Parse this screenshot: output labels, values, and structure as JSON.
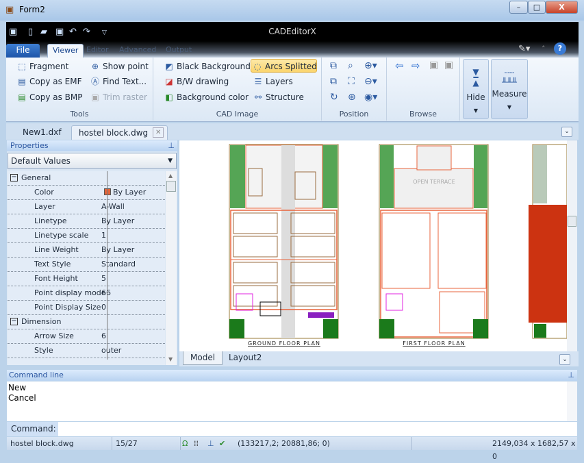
{
  "window": {
    "title": "Form2",
    "app_title": "CADEditorX",
    "min": "–",
    "max": "□",
    "close": "X"
  },
  "ribbon_tabs": [
    "File",
    "Viewer",
    "Editor",
    "Advanced",
    "Output"
  ],
  "ribbon": {
    "tools": {
      "label": "Tools",
      "items": [
        "Fragment",
        "Copy as EMF",
        "Copy as BMP",
        "Show point",
        "Find Text...",
        "Trim raster"
      ]
    },
    "cad_image": {
      "label": "CAD Image",
      "items": [
        "Black Background",
        "B/W drawing",
        "Background color",
        "Arcs Splitted",
        "Layers",
        "Structure"
      ]
    },
    "position": {
      "label": "Position"
    },
    "browse": {
      "label": "Browse"
    },
    "hide": "Hide",
    "measure": "Measure"
  },
  "doc_tabs": [
    "New1.dxf",
    "hostel block.dwg"
  ],
  "properties": {
    "title": "Properties",
    "combo": "Default Values",
    "rows": [
      {
        "cat": true,
        "k": "General"
      },
      {
        "k": "Color",
        "v": "By Layer",
        "swatch": "#e2643a"
      },
      {
        "k": "Layer",
        "v": "A-Wall"
      },
      {
        "k": "Linetype",
        "v": "By Layer"
      },
      {
        "k": "Linetype scale",
        "v": "1"
      },
      {
        "k": "Line Weight",
        "v": "By Layer"
      },
      {
        "k": "Text Style",
        "v": "Standard"
      },
      {
        "k": "Font Height",
        "v": "5"
      },
      {
        "k": "Point display mode",
        "v": "66"
      },
      {
        "k": "Point Display Size",
        "v": "0"
      },
      {
        "cat": true,
        "k": "Dimension"
      },
      {
        "k": "Arrow Size",
        "v": "6"
      },
      {
        "k": "Style",
        "v": "outer"
      }
    ]
  },
  "drawing": {
    "plan1": "GROUND FLOOR PLAN",
    "plan2": "FIRST FLOOR PLAN",
    "terrace": "OPEN TERRACE"
  },
  "layout_tabs": [
    "Model",
    "Layout2"
  ],
  "command": {
    "title": "Command line",
    "history": [
      "New",
      "Cancel"
    ],
    "label": "Command:",
    "value": ""
  },
  "status": {
    "file": "hostel block.dwg",
    "count": "15/27",
    "coords": "(133217,2; 20881,86; 0)",
    "size": "2149,034 x 1682,57 x 0"
  },
  "colors": {
    "wall": "#e8643c",
    "furniture": "#9a6b3f",
    "tree": "#1c8a1c",
    "roof": "#cc3311"
  }
}
